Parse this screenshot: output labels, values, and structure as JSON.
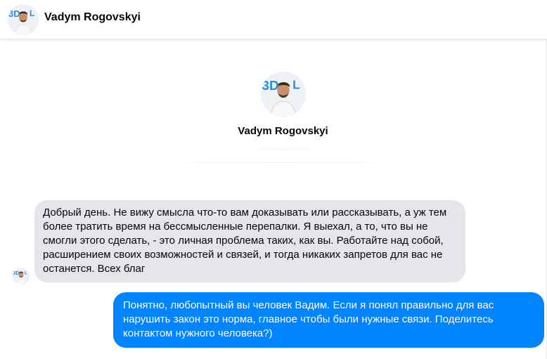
{
  "header": {
    "contact_name": "Vadym Rogovskyi",
    "avatar_icon": "profile-photo-avatar"
  },
  "profile": {
    "name": "Vadym Rogovskyi",
    "avatar_icon": "profile-photo-avatar",
    "avatar_logo_text": "3D"
  },
  "messages": [
    {
      "direction": "incoming",
      "text": "Добрый день. Не вижу смысла что-то вам доказывать или рассказывать, а уж тем более тратить время на бессмысленные перепалки. Я выехал, а то, что вы не смогли этого сделать, - это личная проблема таких, как вы. Работайте над собой, расширением своих возможностей и связей, и тогда никаких запретов для вас не останется. Всех благ"
    },
    {
      "direction": "outgoing",
      "text": "Понятно, любопытный вы человек Вадим. Если я понял правильно для вас нарушить закон это норма, главное чтобы были нужные связи. Поделитесь контактом нужного человека?)"
    }
  ],
  "colors": {
    "outgoing_bubble": "#0084ff",
    "incoming_bubble": "#e4e6eb",
    "logo_blue": "#2a8ee0"
  }
}
